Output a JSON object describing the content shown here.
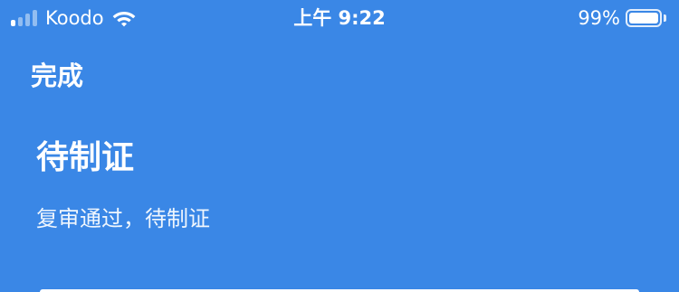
{
  "status_bar": {
    "carrier": "Koodo",
    "signal_bars_total": 4,
    "signal_bars_active": 1,
    "time": "上午 9:22",
    "battery_percent_label": "99%",
    "battery_level": 0.99
  },
  "nav": {
    "done_label": "完成"
  },
  "main": {
    "title": "待制证",
    "subtitle": "复审通过，待制证"
  },
  "colors": {
    "background": "#3a87e6",
    "text": "#ffffff"
  }
}
